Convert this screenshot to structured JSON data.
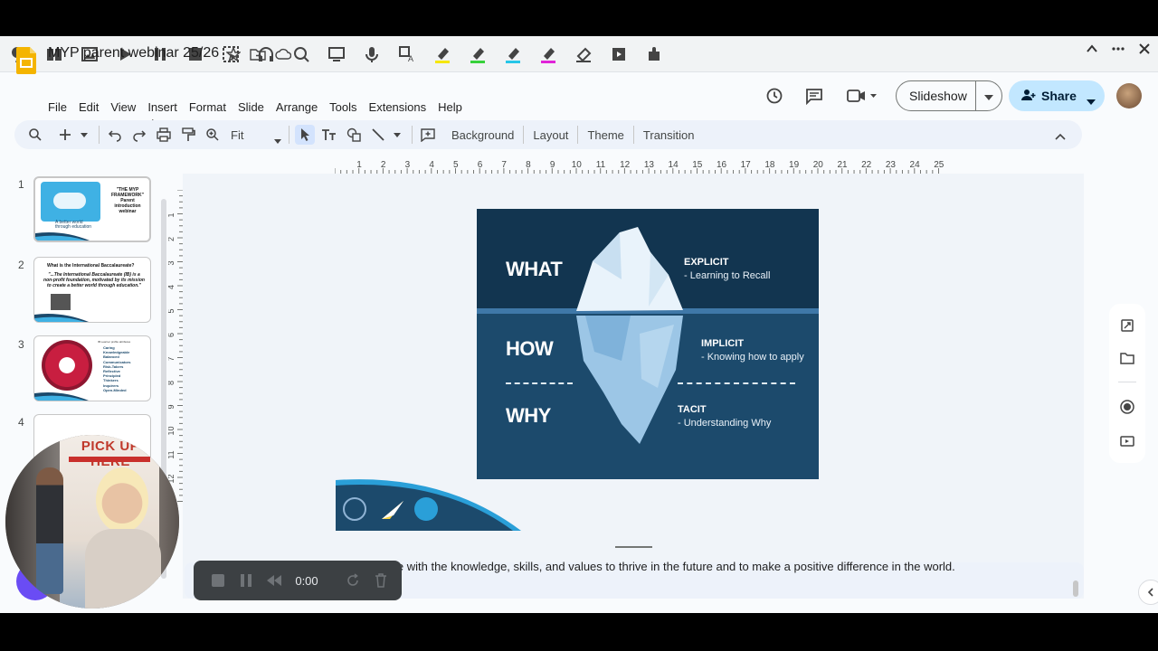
{
  "document": {
    "title": "MYP parent webinar 25/26"
  },
  "menu": [
    "File",
    "Edit",
    "View",
    "Insert",
    "Format",
    "Slide",
    "Arrange",
    "Tools",
    "Extensions",
    "Help"
  ],
  "header": {
    "slideshow_label": "Slideshow",
    "share_label": "Share"
  },
  "toolbar": {
    "zoom_value": "Fit",
    "background": "Background",
    "layout": "Layout",
    "theme": "Theme",
    "transition": "Transition"
  },
  "ruler": {
    "h_ticks": [
      "1",
      "2",
      "3",
      "4",
      "5",
      "6",
      "7",
      "8",
      "9",
      "10",
      "11",
      "12",
      "13",
      "14",
      "15",
      "16",
      "17",
      "18",
      "19",
      "20",
      "21",
      "22",
      "23",
      "24",
      "25"
    ],
    "v_ticks": [
      "1",
      "2",
      "3",
      "4",
      "5",
      "6",
      "7",
      "8",
      "9",
      "10",
      "11",
      "12",
      "13"
    ]
  },
  "filmstrip": [
    {
      "num": "1",
      "text_lines": [
        "\"THE MYP",
        "FRAMEWORK\"",
        "Parent",
        "introduction",
        "webinar"
      ],
      "bottom_text": "A better world\nthrough education"
    },
    {
      "num": "2",
      "heading": "What is the International Baccalaureate?",
      "quote": "\"...The International Baccalaureate (IB) is a non-profit foundation, motivated by its mission to create a better world through education.\""
    },
    {
      "num": "3",
      "heading": "IB Learner profile attributes",
      "items": [
        "Caring",
        "Knowledgeable",
        "Balanced",
        "Communicators",
        "Risk-Takers",
        "Reflective",
        "Principled",
        "Thinkers",
        "Inquirers",
        "Open-Minded"
      ]
    },
    {
      "num": "4",
      "banner": "PICK UP HERE"
    }
  ],
  "slide": {
    "what": "WHAT",
    "how": "HOW",
    "why": "WHY",
    "explicit_head": "EXPLICIT",
    "explicit_sub": "- Learning to Recall",
    "implicit_head": "IMPLICIT",
    "implicit_sub": "- Knowing how to apply",
    "tacit_head": "TACIT",
    "tacit_sub": "- Understanding Why"
  },
  "notes": {
    "text": "le with the knowledge, skills, and values to thrive in the future and to make a positive difference in the world."
  },
  "recorder": {
    "time": "0:00"
  },
  "colors": {
    "accent": "#c2e7ff",
    "iceberg_dark": "#123550",
    "iceberg_water": "#1c4a6c",
    "recorder_bg": "#3c4043"
  }
}
